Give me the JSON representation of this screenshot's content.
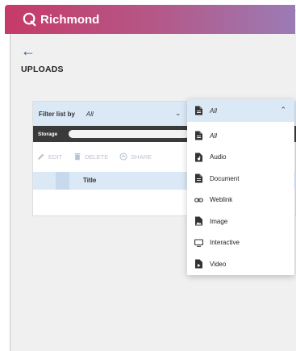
{
  "brand": {
    "name": "Richmond"
  },
  "page": {
    "back_icon": "arrow-left-icon",
    "title": "UPLOADS"
  },
  "filter": {
    "label": "Filter list by",
    "value": "All"
  },
  "storage": {
    "label": "Storage",
    "used_fraction": 0.0
  },
  "actions": [
    {
      "label": "EDIT",
      "icon": "pencil-icon"
    },
    {
      "label": "DELETE",
      "icon": "trash-icon"
    },
    {
      "label": "SHARE",
      "icon": "share-icon"
    }
  ],
  "table": {
    "title_header": "Title"
  },
  "dropdown": {
    "selected": "All",
    "options": [
      {
        "label": "All",
        "icon": "file-icon"
      },
      {
        "label": "Audio",
        "icon": "audio-file-icon"
      },
      {
        "label": "Document",
        "icon": "document-icon"
      },
      {
        "label": "Weblink",
        "icon": "link-icon"
      },
      {
        "label": "Image",
        "icon": "image-icon"
      },
      {
        "label": "Interactive",
        "icon": "monitor-icon"
      },
      {
        "label": "Video",
        "icon": "video-file-icon"
      }
    ]
  },
  "colors": {
    "brand_start": "#c63a68",
    "brand_end": "#9b7bb6",
    "accent_blue": "#1b5fa8",
    "header_tint": "#dbe8f6"
  }
}
